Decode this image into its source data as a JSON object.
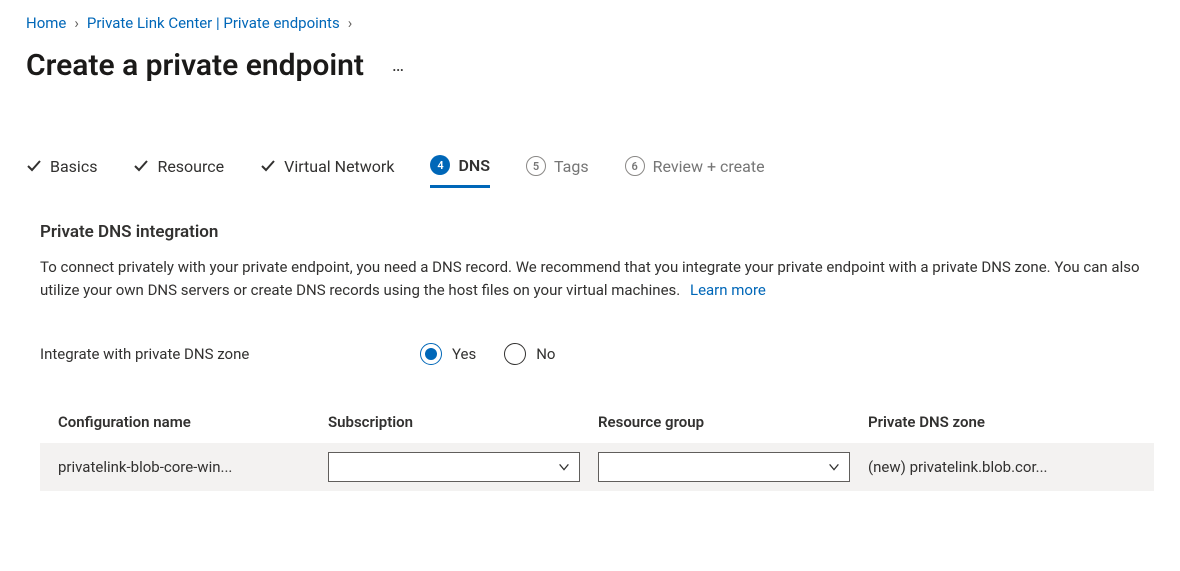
{
  "breadcrumb": {
    "home": "Home",
    "mid": "Private Link Center | Private endpoints"
  },
  "title": "Create a private endpoint",
  "tabs": {
    "basics": "Basics",
    "resource": "Resource",
    "vnet": "Virtual Network",
    "dns_num": "4",
    "dns": "DNS",
    "tags_num": "5",
    "tags": "Tags",
    "review_num": "6",
    "review": "Review + create"
  },
  "section": {
    "heading": "Private DNS integration",
    "desc": "To connect privately with your private endpoint, you need a DNS record. We recommend that you integrate your private endpoint with a private DNS zone. You can also utilize your own DNS servers or create DNS records using the host files on your virtual machines.",
    "learn": "Learn more"
  },
  "form": {
    "label": "Integrate with private DNS zone",
    "yes": "Yes",
    "no": "No"
  },
  "table": {
    "headers": {
      "config": "Configuration name",
      "sub": "Subscription",
      "rg": "Resource group",
      "zone": "Private DNS zone"
    },
    "row": {
      "config": "privatelink-blob-core-win...",
      "zone": "(new) privatelink.blob.cor..."
    }
  }
}
